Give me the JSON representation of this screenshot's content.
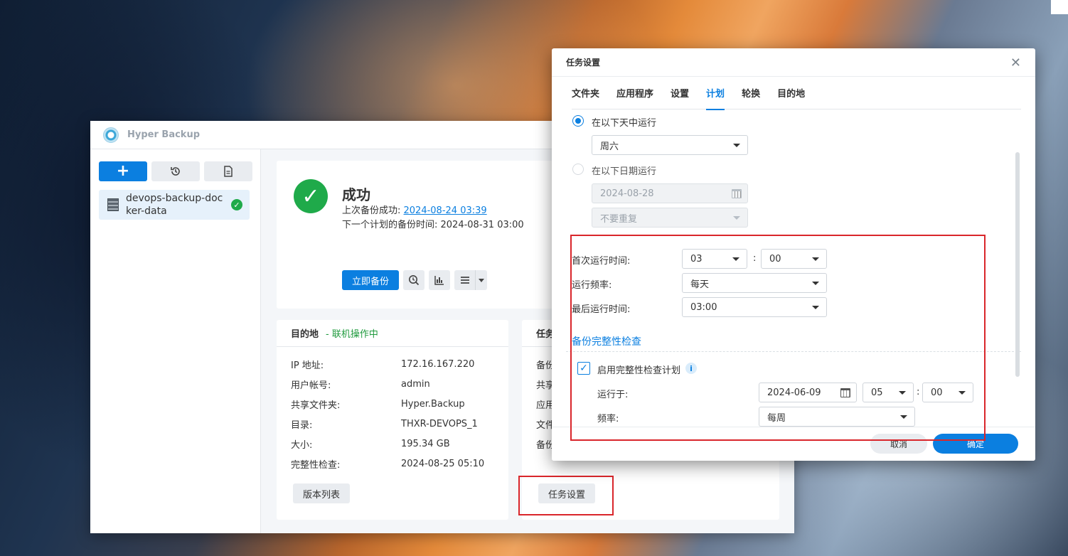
{
  "app": {
    "title": "Hyper Backup"
  },
  "sidebar": {
    "add_label": "+",
    "task_name": "devops-backup-docker-data"
  },
  "status": {
    "title": "成功",
    "last_backup_label": "上次备份成功: ",
    "last_backup_value": "2024-08-24 03:39",
    "next_backup_text": "下一个计划的备份时间: 2024-08-31 03:00",
    "backup_now_label": "立即备份"
  },
  "destination": {
    "header": "目的地",
    "online_status": "- 联机操作中",
    "rows": [
      {
        "key": "IP 地址:",
        "value": "172.16.167.220"
      },
      {
        "key": "用户帐号:",
        "value": "admin"
      },
      {
        "key": "共享文件夹:",
        "value": "Hyper.Backup"
      },
      {
        "key": "目录:",
        "value": "THXR-DEVOPS_1"
      },
      {
        "key": "大小:",
        "value": "195.34 GB"
      },
      {
        "key": "完整性检查:",
        "value": "2024-08-25 05:10"
      }
    ],
    "version_list_label": "版本列表"
  },
  "task_card": {
    "header": "任务",
    "labels": [
      "备份",
      "共享",
      "应用",
      "文件",
      "备份"
    ],
    "task_settings_label": "任务设置"
  },
  "dialog": {
    "title": "任务设置",
    "close_symbol": "✕",
    "tabs": [
      "文件夹",
      "应用程序",
      "设置",
      "计划",
      "轮换",
      "目的地"
    ],
    "active_tab": "计划",
    "run_on_days_label": "在以下天中运行",
    "day_value": "周六",
    "run_on_date_label": "在以下日期运行",
    "date_value": "2024-08-28",
    "repeat_value": "不要重复",
    "first_run_label": "首次运行时间:",
    "first_run_hour": "03",
    "first_run_minute": "00",
    "frequency_label": "运行频率:",
    "frequency_value": "每天",
    "last_run_label": "最后运行时间:",
    "last_run_value": "03:00",
    "integrity_section_title": "备份完整性检查",
    "enable_integrity_label": "启用完整性检查计划",
    "run_at_label": "运行于:",
    "integrity_date": "2024-06-09",
    "integrity_hour": "05",
    "integrity_minute": "00",
    "integrity_freq_label": "频率:",
    "integrity_freq_value": "每周",
    "cancel_label": "取消",
    "ok_label": "确定"
  },
  "colors": {
    "accent": "#0b7fe0",
    "success": "#1faa4a",
    "highlight_border": "#d9262b"
  }
}
